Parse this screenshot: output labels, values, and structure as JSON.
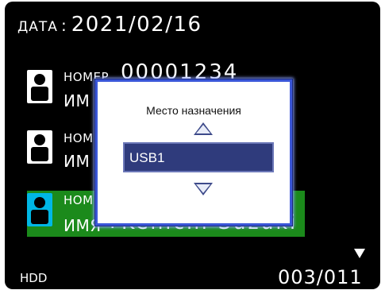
{
  "header": {
    "date_label": "ДАТА",
    "date_value": "2021/02/16"
  },
  "records": [
    {
      "number_label": "НОМЕР",
      "number_value": "00001234",
      "name_label": "ИМ",
      "name_value": ""
    },
    {
      "number_label": "НОМ",
      "name_label": "ИМ"
    },
    {
      "number_label": "НОМ",
      "name_label": "ИМЯ",
      "name_value": "Kenichi Suzuki",
      "selected": true
    }
  ],
  "dialog": {
    "title": "Место назначения",
    "value": "USB1",
    "up_icon": "triangle-up-icon",
    "down_icon": "triangle-down-icon"
  },
  "footer": {
    "storage": "HDD",
    "page": "003/011"
  },
  "colors": {
    "screen_bg": "#000000",
    "selected_row": "#1b8a1b",
    "selected_avatar": "#00b7e5",
    "dialog_border": "#3a56d8",
    "select_bg": "#2f3b7c"
  }
}
